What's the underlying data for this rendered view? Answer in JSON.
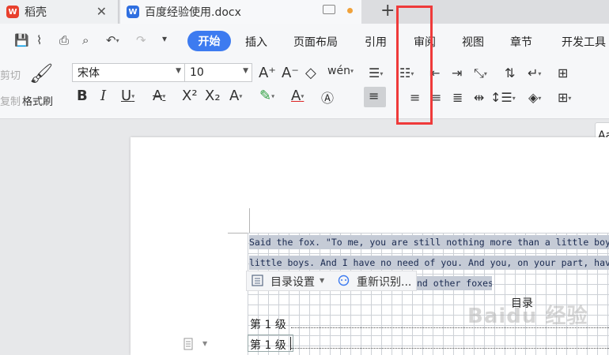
{
  "tabs": [
    {
      "title": "稻壳",
      "icon": "wps-logo-icon"
    },
    {
      "title": "百度经验使用.docx",
      "icon": "word-doc-icon"
    }
  ],
  "colors": {
    "accent": "#3d7bf0",
    "highlight": "#ef3a3a",
    "selection": "#c5cbd6"
  },
  "menu": {
    "start": "开始",
    "insert": "插入",
    "layout": "页面布局",
    "reference": "引用",
    "review": "审阅",
    "view": "视图",
    "section": "章节",
    "developer": "开发工具"
  },
  "ribbon": {
    "cut_label": "剪切",
    "copy_label": "复制",
    "painter_label": "格式刷",
    "font_name": "宋体",
    "font_size": "10",
    "style_preview": "Aa"
  },
  "document": {
    "line1": "Said the fox. \"To me, you are still nothing more than a little boy who is",
    "line2": "little boys. And I have no need of you. And you, on your part, have no",
    "line3_tail": "nd other foxes",
    "toc_settings": "目录设置",
    "toc_reidentify": "重新识别...",
    "toc_title": "目录",
    "entries": [
      "第 1 级",
      "第 1 级"
    ]
  },
  "watermark": "Baidu 经验"
}
